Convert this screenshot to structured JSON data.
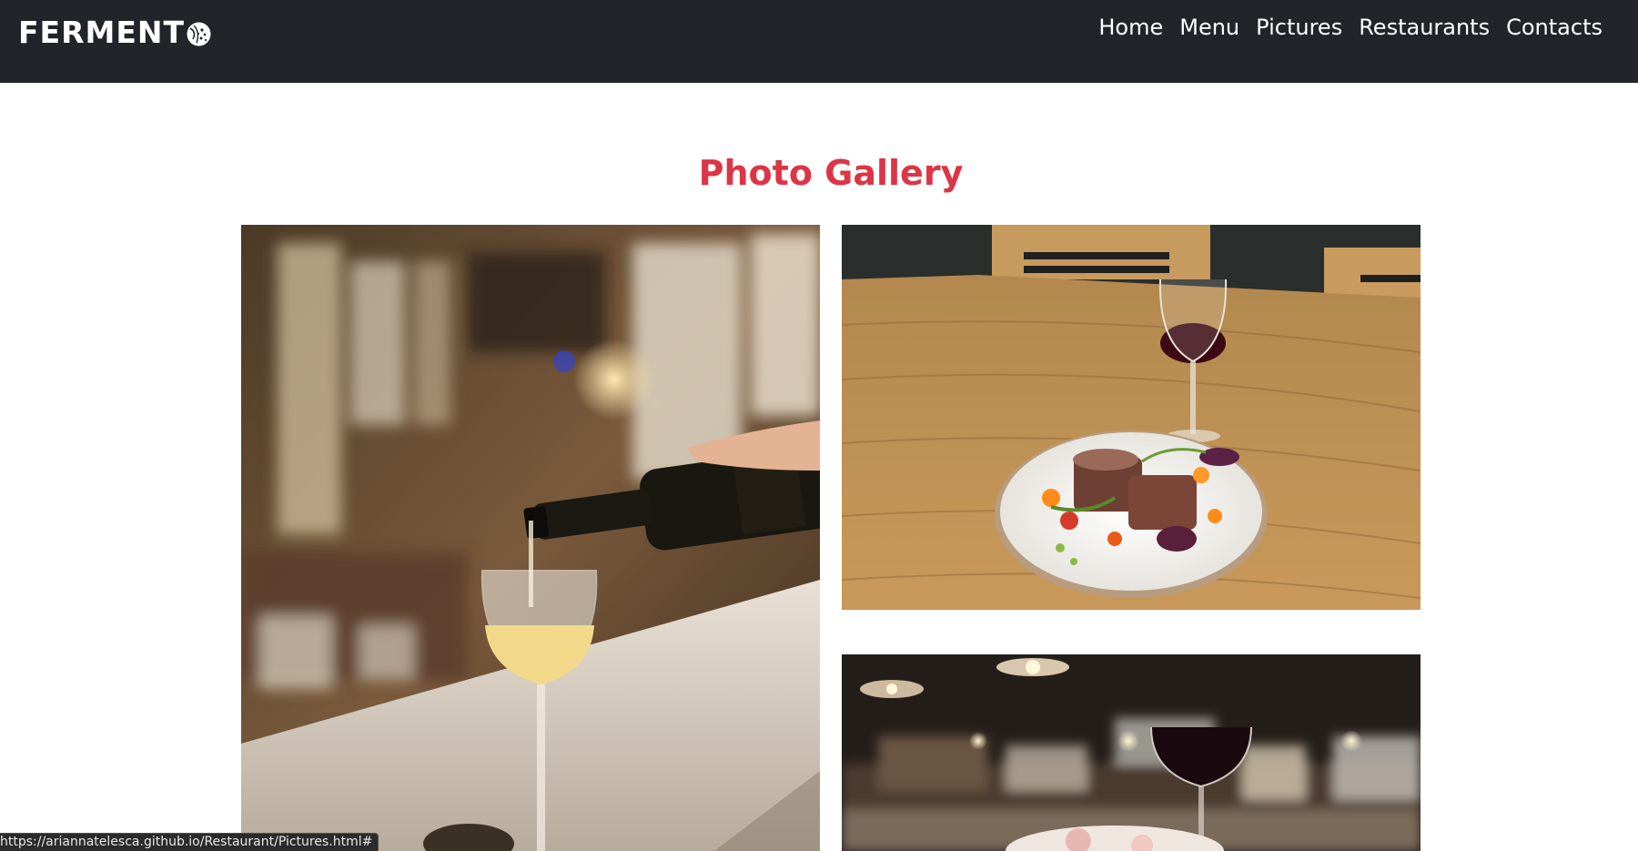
{
  "navbar": {
    "brand": "FERMENT",
    "links": [
      "Home",
      "Menu",
      "Pictures",
      "Restaurants",
      "Contacts"
    ]
  },
  "main": {
    "title": "Photo Gallery"
  },
  "status_bar": {
    "url": "https://ariannatelesca.github.io/Restaurant/Pictures.html#"
  },
  "colors": {
    "navbar_bg": "#212529",
    "title": "#dc3545"
  }
}
